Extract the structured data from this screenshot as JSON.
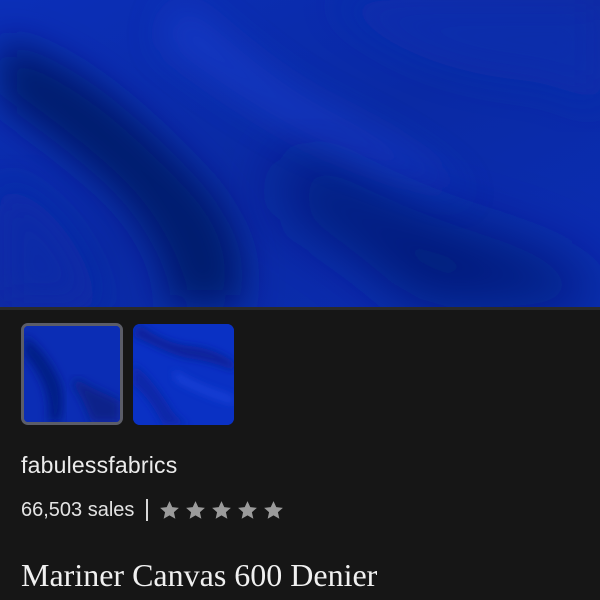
{
  "product": {
    "hero_image_icon": "blue-fabric-photo",
    "thumbnails": [
      {
        "icon": "blue-fabric-thumbnail",
        "selected": true
      },
      {
        "icon": "blue-fabric-folds-thumbnail",
        "selected": false
      }
    ],
    "shop_name": "fabulessfabrics",
    "sales": "66,503 sales",
    "separator": "|",
    "rating": 5,
    "rating_max": 5,
    "title": "Mariner Canvas 600 Denier"
  },
  "colors": {
    "background": "#161616",
    "fabric_blue": "#0a2a9c",
    "star": "#9b9b9b",
    "text": "#ececec"
  }
}
